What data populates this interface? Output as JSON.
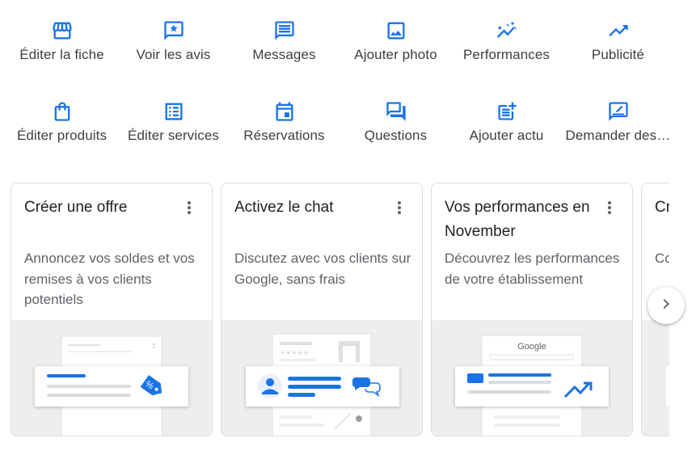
{
  "colors": {
    "accent": "#1a73e8",
    "text": "#3c4043",
    "muted": "#5f6368",
    "illus_bg": "#eeeeee"
  },
  "actions": [
    {
      "label": "Éditer la fiche",
      "icon": "storefront-icon"
    },
    {
      "label": "Voir les avis",
      "icon": "review-star-icon"
    },
    {
      "label": "Messages",
      "icon": "message-icon"
    },
    {
      "label": "Ajouter photo",
      "icon": "photo-icon"
    },
    {
      "label": "Performances",
      "icon": "sparkle-trend-icon"
    },
    {
      "label": "Publicité",
      "icon": "trending-up-icon"
    },
    {
      "label": "Éditer produits",
      "icon": "shopping-bag-icon"
    },
    {
      "label": "Éditer services",
      "icon": "list-alt-icon"
    },
    {
      "label": "Réservations",
      "icon": "calendar-icon"
    },
    {
      "label": "Questions",
      "icon": "forum-icon"
    },
    {
      "label": "Ajouter actu",
      "icon": "post-add-icon"
    },
    {
      "label": "Demander des avis",
      "icon": "rate-review-icon"
    }
  ],
  "cards": [
    {
      "title": "Créer une offre",
      "body": "Annoncez vos soldes et vos remises à vos clients potentiels",
      "menu_icon": "more-vert-icon"
    },
    {
      "title": "Activez le chat",
      "body": "Discutez avec vos clients sur Google, sans frais",
      "menu_icon": "more-vert-icon"
    },
    {
      "title": "Vos performances en November",
      "body": "Découvrez les performances de votre établissement",
      "menu_icon": "more-vert-icon",
      "illus_brand": "Google"
    },
    {
      "title": "Créer e-",
      "body": "Co @"
    }
  ],
  "carousel": {
    "next_icon": "chevron-right-icon"
  }
}
